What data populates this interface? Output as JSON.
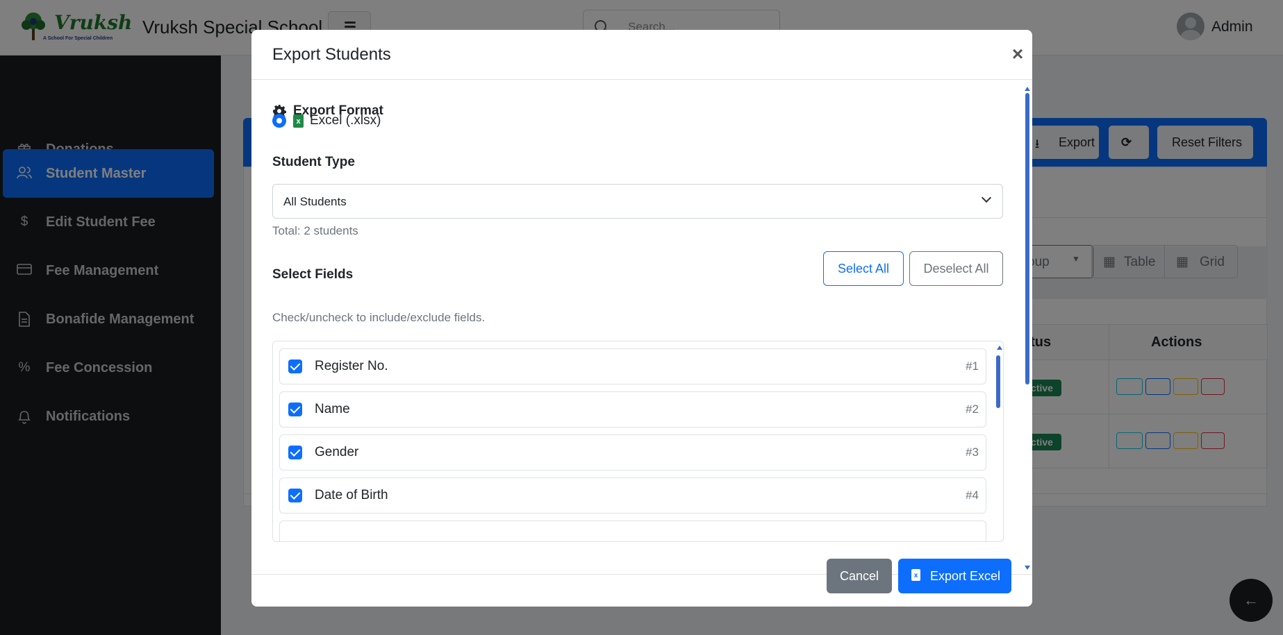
{
  "header": {
    "logo_text": "Vruksh",
    "logo_subtext": "A School For Special Children",
    "school_name": "Vruksh Special School",
    "search_placeholder": "Search...",
    "user_name": "Admin"
  },
  "sidebar": {
    "items": [
      {
        "label": "Donations",
        "icon": "gift-icon",
        "active": false
      },
      {
        "label": "Student Master",
        "icon": "users-icon",
        "active": true
      },
      {
        "label": "Edit Student Fee",
        "icon": "dollar-icon",
        "active": false
      },
      {
        "label": "Fee Management",
        "icon": "credit-card-icon",
        "active": false
      },
      {
        "label": "Bonafide Management",
        "icon": "document-icon",
        "active": false
      },
      {
        "label": "Fee Concession",
        "icon": "percent-icon",
        "active": false
      },
      {
        "label": "Notifications",
        "icon": "bell-icon",
        "active": false
      }
    ]
  },
  "background": {
    "export_label": "Export",
    "reset_filters_label": "Reset Filters",
    "group_label": "oup",
    "table_view_label": "Table",
    "grid_view_label": "Grid",
    "status_header": "atus",
    "actions_header": "Actions",
    "status_badge": "ctive"
  },
  "modal": {
    "title": "Export Students",
    "close_symbol": "×",
    "export_format_heading": "Export Format",
    "format_option": "Excel (.xlsx)",
    "student_type_label": "Student Type",
    "student_type_value": "All Students",
    "total_text": "Total: 2 students",
    "select_fields_label": "Select Fields",
    "select_all_label": "Select All",
    "deselect_all_label": "Deselect All",
    "hint_text": "Check/uncheck to include/exclude fields.",
    "fields": [
      {
        "name": "Register No.",
        "num": "#1"
      },
      {
        "name": "Name",
        "num": "#2"
      },
      {
        "name": "Gender",
        "num": "#3"
      },
      {
        "name": "Date of Birth",
        "num": "#4"
      }
    ],
    "cancel_label": "Cancel",
    "export_excel_label": "Export Excel"
  },
  "colors": {
    "primary": "#0d6efd",
    "sidebar_bg": "#1a1d21",
    "success": "#198754",
    "secondary": "#6c757d"
  }
}
